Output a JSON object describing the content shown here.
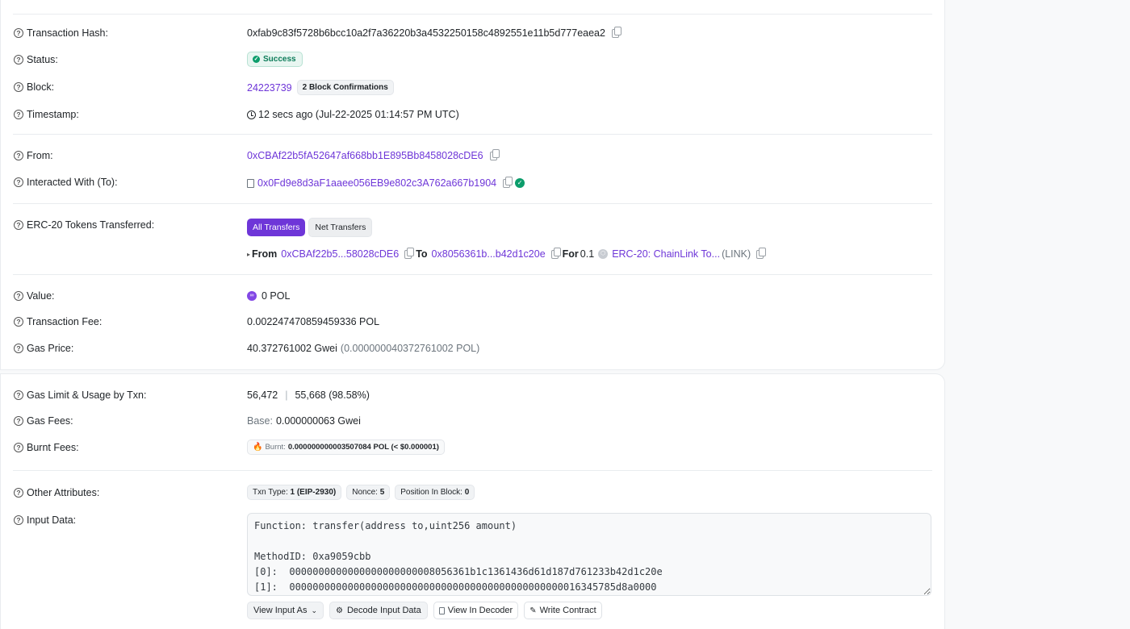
{
  "tx": {
    "hash_label": "Transaction Hash:",
    "hash": "0xfab9c83f5728b6bcc10a2f7a36220b3a4532250158c4892551e11b5d777eaea2",
    "status_label": "Status:",
    "status": "Success",
    "block_label": "Block:",
    "block": "24223739",
    "confirmations": "2 Block Confirmations",
    "timestamp_label": "Timestamp:",
    "timestamp": "12 secs ago (Jul-22-2025 01:14:57 PM UTC)",
    "from_label": "From:",
    "from": "0xCBAf22b5fA52647af668bb1E895Bb8458028cDE6",
    "to_label": "Interacted With (To):",
    "to": "0x0Fd9e8d3aF1aaee056EB9e802c3A762a667b1904"
  },
  "tokens": {
    "label": "ERC-20 Tokens Transferred:",
    "tab_all": "All Transfers",
    "tab_net": "Net Transfers",
    "from_word": "From",
    "from_addr": "0xCBAf22b5...58028cDE6",
    "to_word": "To",
    "to_addr": "0x8056361b...b42d1c20e",
    "for_word": "For",
    "amount": "0.1",
    "token_name": "ERC-20: ChainLink To...",
    "token_symbol": "(LINK)"
  },
  "value": {
    "value_label": "Value:",
    "value": "0 POL",
    "fee_label": "Transaction Fee:",
    "fee": "0.002247470859459336 POL",
    "gas_price_label": "Gas Price:",
    "gas_price": "40.372761002 Gwei",
    "gas_price_pol": "(0.000000040372761002 POL)"
  },
  "gas": {
    "limit_label": "Gas Limit & Usage by Txn:",
    "limit": "56,472",
    "separator": "|",
    "usage": "55,668 (98.58%)",
    "fees_label": "Gas Fees:",
    "base_word": "Base:",
    "base": "0.000000063 Gwei",
    "burnt_label": "Burnt Fees:",
    "burnt_word": "Burnt:",
    "burnt": "0.000000000003507084 POL (< $0.000001)"
  },
  "attributes": {
    "label": "Other Attributes:",
    "txn_type_word": "Txn Type:",
    "txn_type": "1 (EIP-2930)",
    "nonce_word": "Nonce:",
    "nonce": "5",
    "position_word": "Position In Block:",
    "position": "0"
  },
  "input": {
    "label": "Input Data:",
    "text": "Function: transfer(address to,uint256 amount)\n\nMethodID: 0xa9059cbb\n[0]:  0000000000000000000000008056361b1c1361436d61d187d761233b42d1c20e\n[1]:  00000000000000000000000000000000000000000000000016345785d8a0000",
    "view_as": "View Input As",
    "decode": "Decode Input Data",
    "view_decoder": "View In Decoder",
    "write_contract": "Write Contract"
  },
  "icons": {
    "help": "help-circle-icon",
    "copy": "copy-icon",
    "clock": "clock-icon",
    "file": "contract-file-icon",
    "verified": "verified-check-icon",
    "pol": "polygon-icon",
    "fire": "fire-icon"
  },
  "colors": {
    "accent": "#6e36d8",
    "success": "#0c9d6b"
  }
}
